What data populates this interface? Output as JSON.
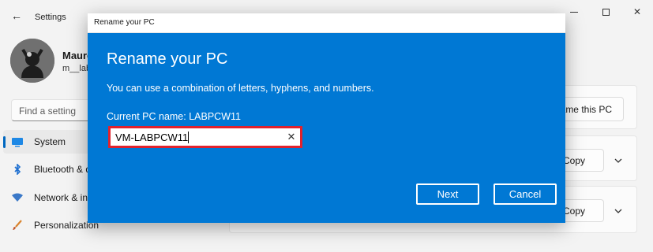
{
  "settings": {
    "title": "Settings",
    "user": {
      "name": "Maure",
      "email": "m__lab"
    },
    "search": {
      "placeholder": "Find a setting"
    },
    "nav": [
      {
        "label": "System",
        "icon": "monitor-icon",
        "selected": true
      },
      {
        "label": "Bluetooth & devices",
        "icon": "bluetooth-icon",
        "selected": false
      },
      {
        "label": "Network & internet",
        "icon": "wifi-icon",
        "selected": false
      },
      {
        "label": "Personalization",
        "icon": "brush-icon",
        "selected": false
      }
    ],
    "content": {
      "rename_pc_label": "Rename this PC",
      "copy_label": "Copy"
    },
    "colors": {
      "accent": "#0067c0",
      "background": "#f3f3f3"
    }
  },
  "dialog": {
    "window_title": "Rename your PC",
    "heading": "Rename your PC",
    "description": "You can use a combination of letters, hyphens, and numbers.",
    "current_name_text": "Current PC name: LABPCW11",
    "input_value": "VM-LABPCW11",
    "next_label": "Next",
    "cancel_label": "Cancel",
    "colors": {
      "background": "#0078d4",
      "highlight_border": "#e1222d"
    }
  }
}
